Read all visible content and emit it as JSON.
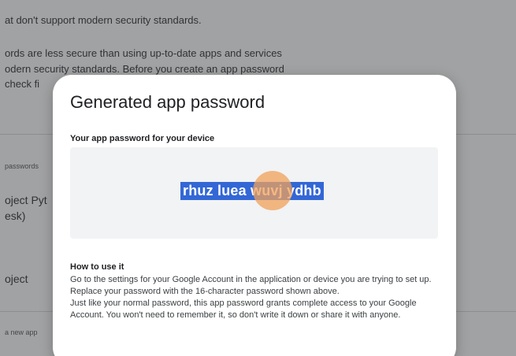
{
  "background": {
    "intro_line1": "at don't support modern security standards.",
    "intro_line2": "ords are less secure than using up-to-date apps and services",
    "intro_line3": "odern security standards. Before you create an app password",
    "intro_line4": "check fi",
    "intro_line5": "",
    "section_label": "passwords",
    "app_item1_line1": "oject Pyt",
    "app_item1_line2": "esk)",
    "app_item2": "oject",
    "new_app_label": "a new app"
  },
  "dialog": {
    "title": "Generated app password",
    "subtitle": "Your app password for your device",
    "password": "rhuz luea wuvj ydhb",
    "how_to_title": "How to use it",
    "how_to_para1": "Go to the settings for your Google Account in the application or device you are trying to set up. Replace your password with the 16-character password shown above.",
    "how_to_para2": "Just like your normal password, this app password grants complete access to your Google Account. You won't need to remember it, so don't write it down or share it with anyone."
  },
  "colors": {
    "selection": "#3367d6",
    "cursor_highlight": "#f0a05a",
    "scrim": "#202124"
  }
}
